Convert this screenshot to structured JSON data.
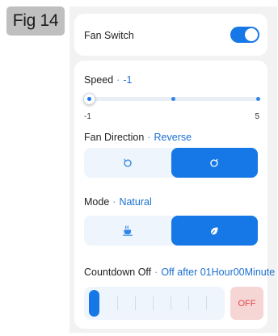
{
  "figure_label": "Fig 14",
  "fan_switch": {
    "label": "Fan Switch",
    "on": true
  },
  "speed": {
    "label": "Speed",
    "separator": "·",
    "value": "-1",
    "min_label": "-1",
    "max_label": "5",
    "level_fraction": 0.0
  },
  "direction": {
    "label": "Fan Direction",
    "separator": "·",
    "value": "Reverse",
    "options": [
      {
        "icon": "rotate-ccw-icon",
        "active": false
      },
      {
        "icon": "rotate-cw-icon",
        "active": true
      }
    ]
  },
  "mode": {
    "label": "Mode",
    "separator": "·",
    "value": "Natural",
    "options": [
      {
        "icon": "coffee-cup-icon",
        "active": false
      },
      {
        "icon": "leaf-icon",
        "active": true
      }
    ]
  },
  "countdown": {
    "label": "Countdown Off",
    "separator": "·",
    "value": "Off after 01Hour00Minute",
    "off_label": "OFF"
  },
  "colors": {
    "accent": "#1677e6",
    "accent_light": "#eff5fc",
    "off_bg": "#f6d5d5",
    "off_text": "#e04a4a"
  }
}
